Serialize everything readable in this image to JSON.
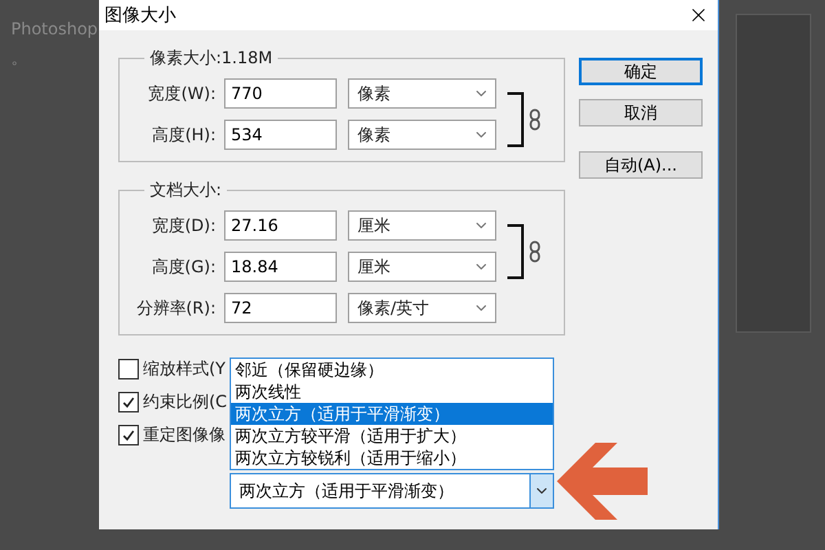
{
  "background_text": [
    "Photoshop",
    "。"
  ],
  "dialog": {
    "title": "图像大小",
    "pixel_size": {
      "legend": "像素大小:1.18M",
      "linked": true,
      "rows": [
        {
          "label": "宽度(W):",
          "value": "770",
          "unit": "像素"
        },
        {
          "label": "高度(H):",
          "value": "534",
          "unit": "像素"
        }
      ]
    },
    "document_size": {
      "legend": "文档大小:",
      "linked": true,
      "rows": [
        {
          "label": "宽度(D):",
          "value": "27.16",
          "unit": "厘米"
        },
        {
          "label": "高度(G):",
          "value": "18.84",
          "unit": "厘米"
        },
        {
          "label": "分辨率(R):",
          "value": "72",
          "unit": "像素/英寸"
        }
      ]
    },
    "buttons": [
      {
        "label": "确定",
        "default": true
      },
      {
        "label": "取消",
        "default": false
      },
      {
        "label": "自动(A)...",
        "default": false
      }
    ],
    "checkboxes": [
      {
        "label": "缩放样式(Y",
        "checked": false
      },
      {
        "label": "约束比例(C",
        "checked": true
      },
      {
        "label": "重定图像像",
        "checked": true
      }
    ],
    "resample": {
      "value": "两次立方（适用于平滑渐变）",
      "expanded": true,
      "options": [
        {
          "label": "邻近（保留硬边缘）",
          "selected": false
        },
        {
          "label": "两次线性",
          "selected": false
        },
        {
          "label": "两次立方（适用于平滑渐变）",
          "selected": true
        },
        {
          "label": "两次立方较平滑（适用于扩大）",
          "selected": false
        },
        {
          "label": "两次立方较锐利（适用于缩小）",
          "selected": false
        }
      ]
    }
  }
}
